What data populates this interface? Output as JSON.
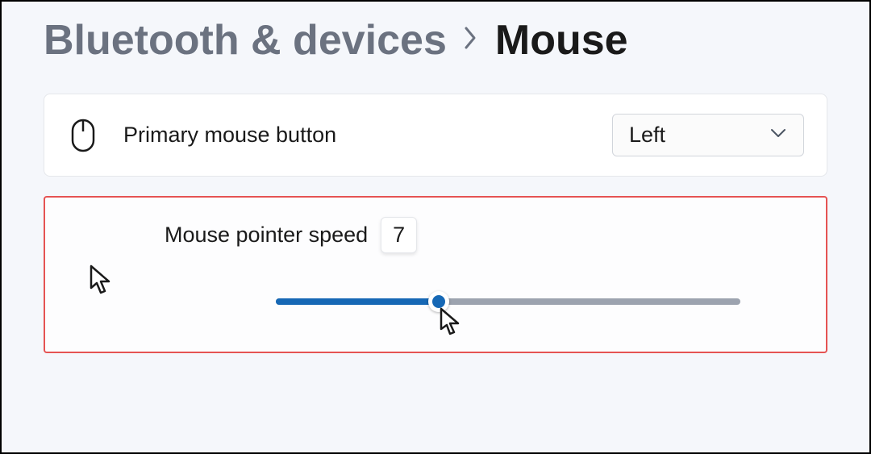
{
  "breadcrumb": {
    "parent": "Bluetooth & devices",
    "current": "Mouse"
  },
  "primaryButton": {
    "label": "Primary mouse button",
    "value": "Left"
  },
  "pointerSpeed": {
    "label": "Mouse pointer speed",
    "value": "7",
    "min": 1,
    "max": 20,
    "percent": 35
  }
}
